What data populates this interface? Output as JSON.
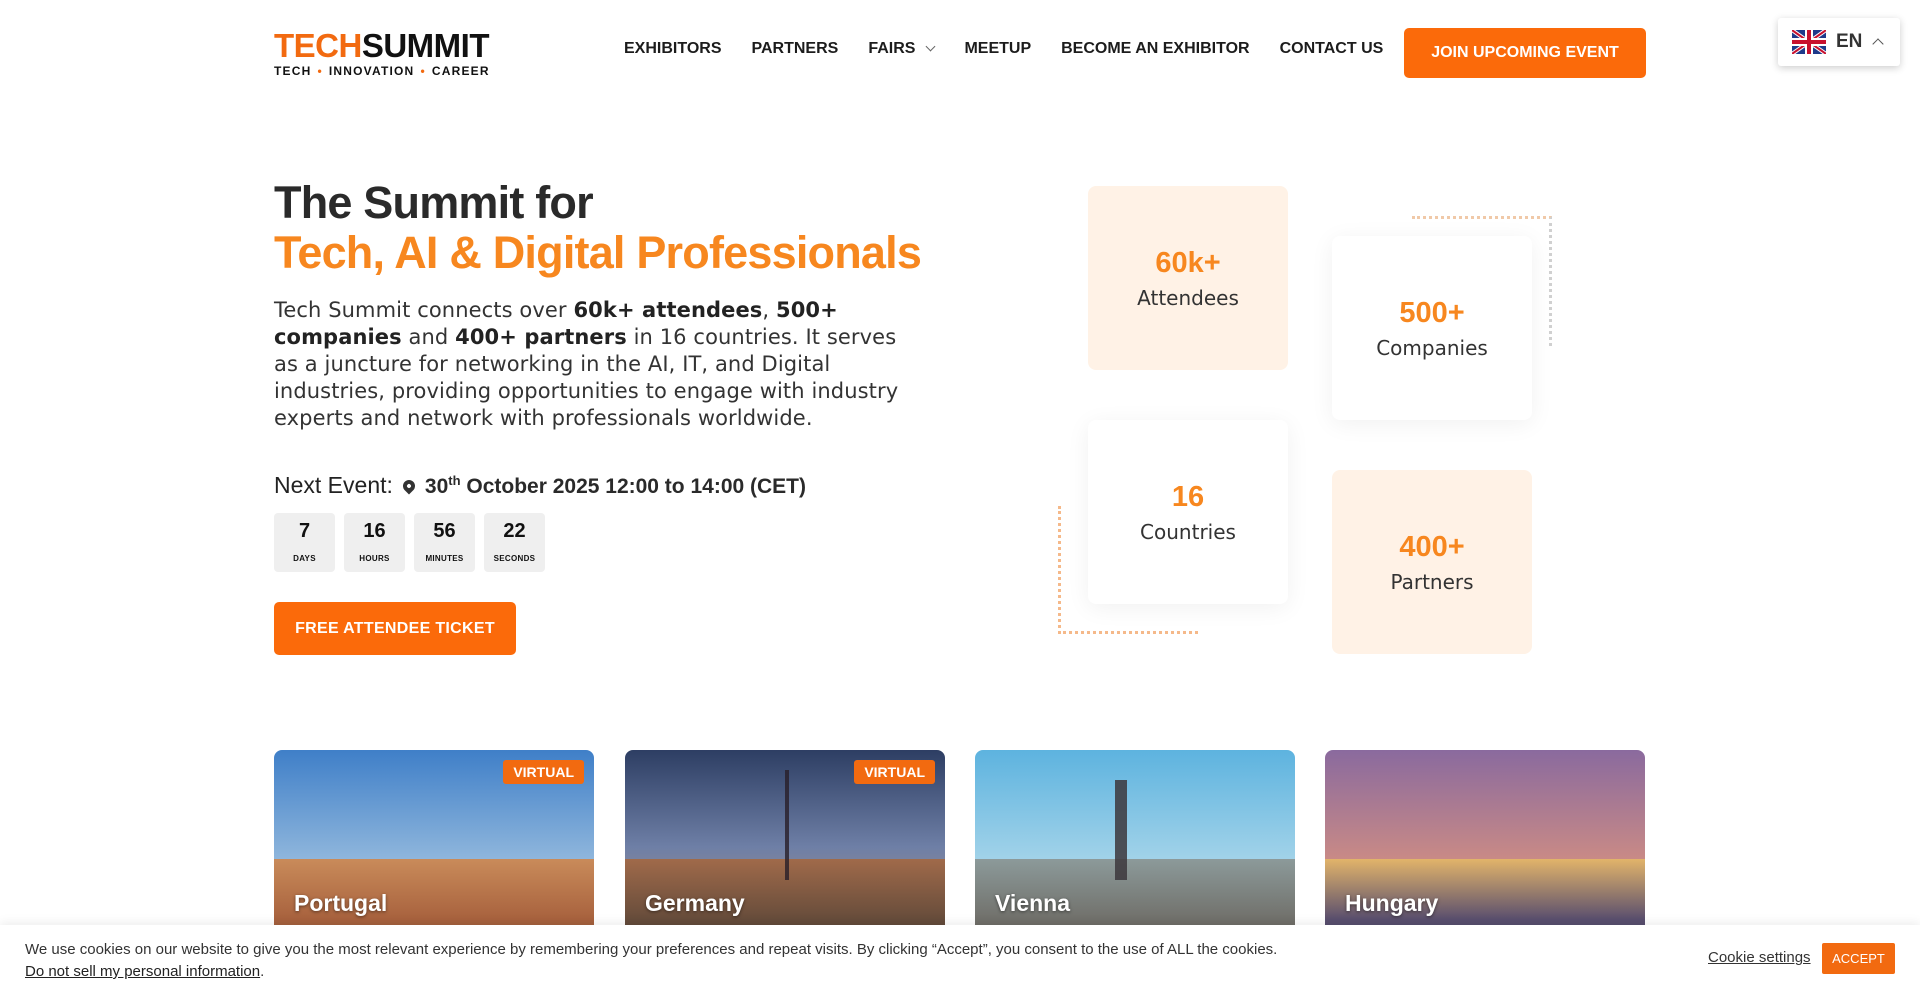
{
  "logo": {
    "main_part1": "TECH",
    "main_part2": "SUMMIT",
    "tag1": "TECH",
    "tag2": "INNOVATION",
    "tag3": "CAREER"
  },
  "nav": {
    "items": [
      "EXHIBITORS",
      "PARTNERS",
      "FAIRS",
      "MEETUP",
      "BECOME AN EXHIBITOR",
      "CONTACT US"
    ],
    "cta": "JOIN UPCOMING EVENT"
  },
  "language": {
    "code": "EN",
    "flag_icon": "uk-flag-icon"
  },
  "hero": {
    "title_line1": "The Summit for",
    "title_line2": "Tech, AI & Digital Professionals",
    "desc": {
      "p1": "Tech Summit connects over ",
      "b1": "60k+ attendees",
      "p2": ", ",
      "b2": "500+ companies",
      "p3": " and ",
      "b3": "400+ partners",
      "p4": " in 16 countries. It serves as a juncture for networking in the AI, IT, and Digital industries, providing opportunities to engage with industry experts and network with professionals worldwide."
    },
    "next_event_label": "Next Event:",
    "next_event_day": "30",
    "next_event_suffix": "th",
    "next_event_rest": " October 2025 12:00 to 14:00 (CET)",
    "countdown": [
      {
        "value": "7",
        "label": "DAYS"
      },
      {
        "value": "16",
        "label": "HOURS"
      },
      {
        "value": "56",
        "label": "MINUTES"
      },
      {
        "value": "22",
        "label": "SECONDS"
      }
    ],
    "ticket_button": "FREE ATTENDEE TICKET"
  },
  "stats": [
    {
      "value": "60k+",
      "label": "Attendees"
    },
    {
      "value": "500+",
      "label": "Companies"
    },
    {
      "value": "16",
      "label": "Countries"
    },
    {
      "value": "400+",
      "label": "Partners"
    }
  ],
  "cards": [
    {
      "name": "Portugal",
      "badge": "VIRTUAL"
    },
    {
      "name": "Germany",
      "badge": "VIRTUAL"
    },
    {
      "name": "Vienna",
      "badge": ""
    },
    {
      "name": "Hungary",
      "badge": ""
    }
  ],
  "cookie": {
    "text": "We use cookies on our website to give you the most relevant experience by remembering your preferences and repeat visits. By clicking “Accept”, you consent to the use of ALL the cookies.",
    "link": "Do not sell my personal information",
    "link_suffix": ".",
    "settings": "Cookie settings",
    "accept": "ACCEPT"
  },
  "colors": {
    "accent": "#fb6a0a",
    "orange_text": "#f7871f",
    "stat_bg": "#fff2e6"
  }
}
